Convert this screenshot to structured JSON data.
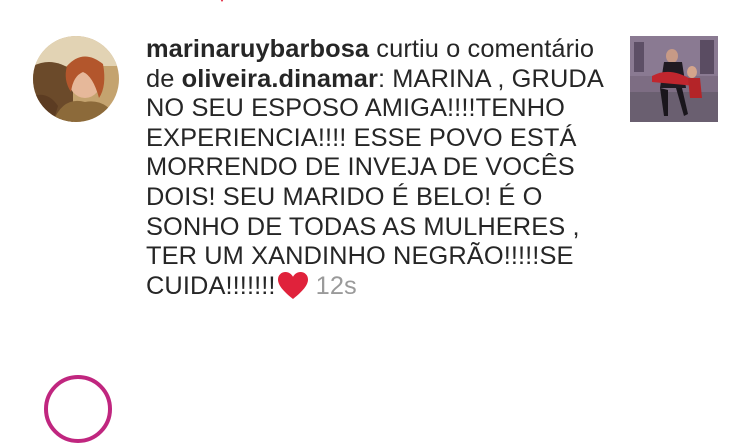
{
  "notification": {
    "username": "marinaruybarbosa",
    "action_text": " curtiu o comentário de ",
    "commenter": "oliveira.dinamar",
    "comment_text": ": MARINA , GRUDA NO SEU ESPOSO AMIGA!!!!TENHO EXPERIENCIA!!!! ESSE POVO ESTÁ MORRENDO DE INVEJA DE VOCÊS DOIS! SEU MARIDO É BELO! É O SONHO DE TODAS AS MULHERES , TER UM XANDINHO NEGRÃO!!!!!SE CUIDA!!!!!!!",
    "timestamp": "12s",
    "heart_icon": "red-heart-emoji",
    "heart_color": "#e0223b"
  },
  "colors": {
    "text": "#262626",
    "timestamp": "#9a9a9a",
    "story_ring": "#c0267f"
  }
}
